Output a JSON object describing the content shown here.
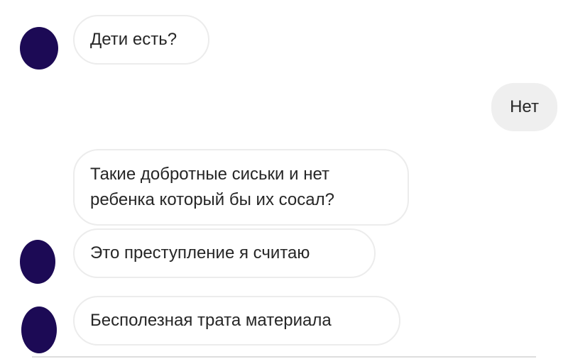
{
  "chat": {
    "messages": [
      {
        "direction": "incoming",
        "lines": [
          "Дети есть?"
        ]
      },
      {
        "direction": "outgoing",
        "lines": [
          "Нет"
        ]
      },
      {
        "direction": "incoming",
        "lines": [
          "Такие добротные сиськи и нет",
          "ребенка который бы их сосал?"
        ]
      },
      {
        "direction": "incoming",
        "lines": [
          "Это преступление я считаю"
        ]
      },
      {
        "direction": "incoming",
        "lines": [
          "Бесполезная трата материала"
        ]
      }
    ]
  },
  "colors": {
    "avatar": "#1c0a55",
    "incoming_border": "#ececec",
    "outgoing_bg": "#efefef",
    "text": "#262626"
  }
}
